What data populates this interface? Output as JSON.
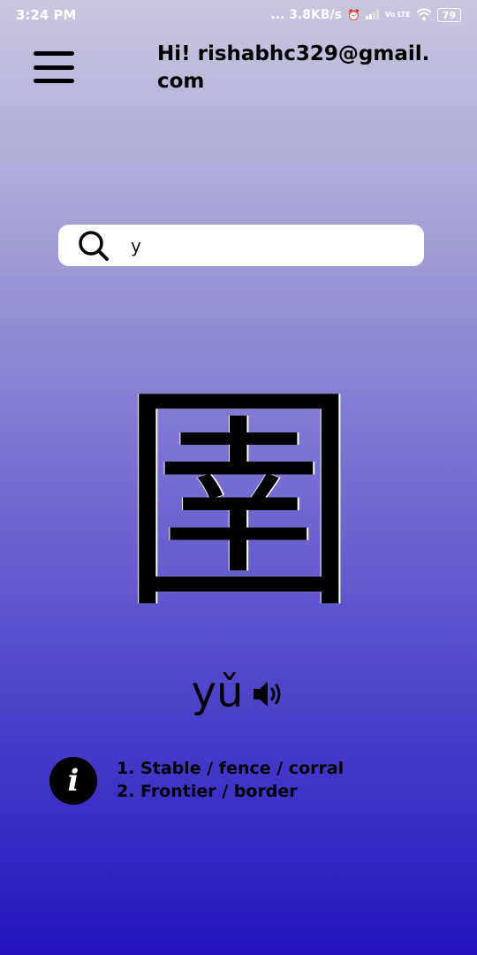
{
  "status_bar": {
    "time": "3:24 PM",
    "network_speed": "... 3.8KB/s",
    "volte_label": "Vo LTE",
    "battery": "79"
  },
  "header": {
    "greeting": "Hi! rishabhc329@gmail.com"
  },
  "search": {
    "value": "y",
    "placeholder": ""
  },
  "character": {
    "hanzi": "圉",
    "pinyin": "yǔ"
  },
  "definitions": [
    "1. Stable / fence / corral",
    "2. Frontier / border"
  ],
  "icons": {
    "menu": "menu-icon",
    "search": "search-icon",
    "speaker": "speaker-icon",
    "info": "info-icon",
    "alarm": "alarm-icon",
    "signal": "signal-icon",
    "wifi": "wifi-icon",
    "battery": "battery-icon"
  },
  "colors": {
    "gradient_top": "#c9c7df",
    "gradient_bottom": "#2413be",
    "text": "#000000",
    "search_bg": "#ffffff"
  }
}
